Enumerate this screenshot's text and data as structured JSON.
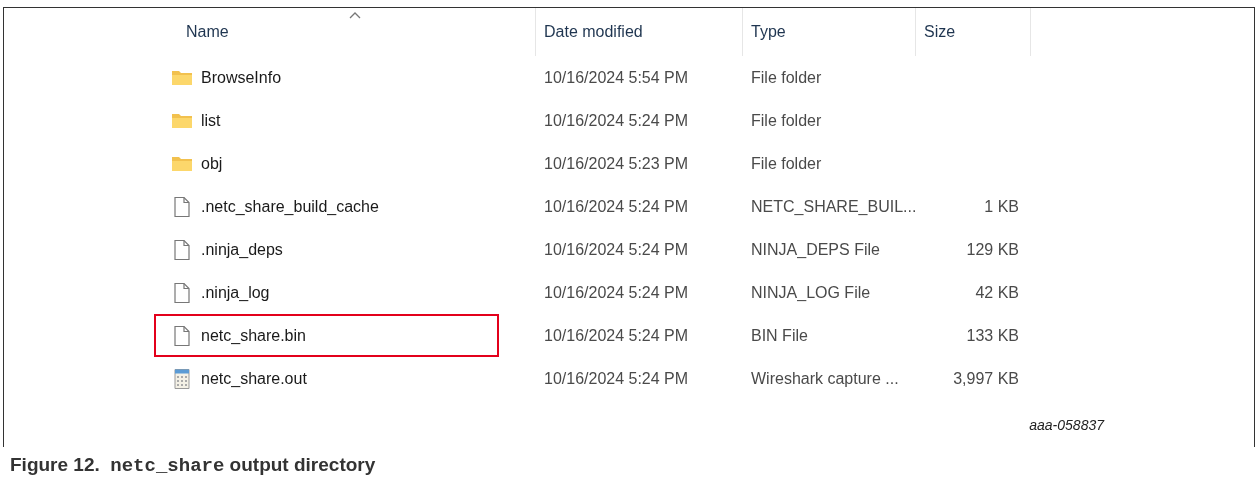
{
  "columns": [
    {
      "label": "Name",
      "sorted": true
    },
    {
      "label": "Date modified"
    },
    {
      "label": "Type"
    },
    {
      "label": "Size"
    }
  ],
  "rows": [
    {
      "kind": "folder",
      "name": "BrowseInfo",
      "date": "10/16/2024 5:54 PM",
      "type": "File folder",
      "highlighted": false
    },
    {
      "kind": "folder",
      "name": "list",
      "date": "10/16/2024 5:24 PM",
      "type": "File folder",
      "highlighted": false
    },
    {
      "kind": "folder",
      "name": "obj",
      "date": "10/16/2024 5:23 PM",
      "type": "File folder",
      "highlighted": false
    },
    {
      "kind": "file",
      "name": ".netc_share_build_cache",
      "date": "10/16/2024 5:24 PM",
      "type": "NETC_SHARE_BUIL...",
      "size": "1 KB",
      "highlighted": false
    },
    {
      "kind": "file",
      "name": ".ninja_deps",
      "date": "10/16/2024 5:24 PM",
      "type": "NINJA_DEPS File",
      "size": "129 KB",
      "highlighted": false
    },
    {
      "kind": "file",
      "name": ".ninja_log",
      "date": "10/16/2024 5:24 PM",
      "type": "NINJA_LOG File",
      "size": "42 KB",
      "highlighted": false
    },
    {
      "kind": "file",
      "name": "netc_share.bin",
      "date": "10/16/2024 5:24 PM",
      "type": "BIN File",
      "size": "133 KB",
      "highlighted": true
    },
    {
      "kind": "capture",
      "name": "netc_share.out",
      "date": "10/16/2024 5:24 PM",
      "type": "Wireshark capture ...",
      "size": "3,997 KB",
      "highlighted": false
    }
  ],
  "figure_id": "aaa-058837",
  "caption": {
    "label": "Figure 12.",
    "code": "netc_share",
    "text": "output directory"
  }
}
